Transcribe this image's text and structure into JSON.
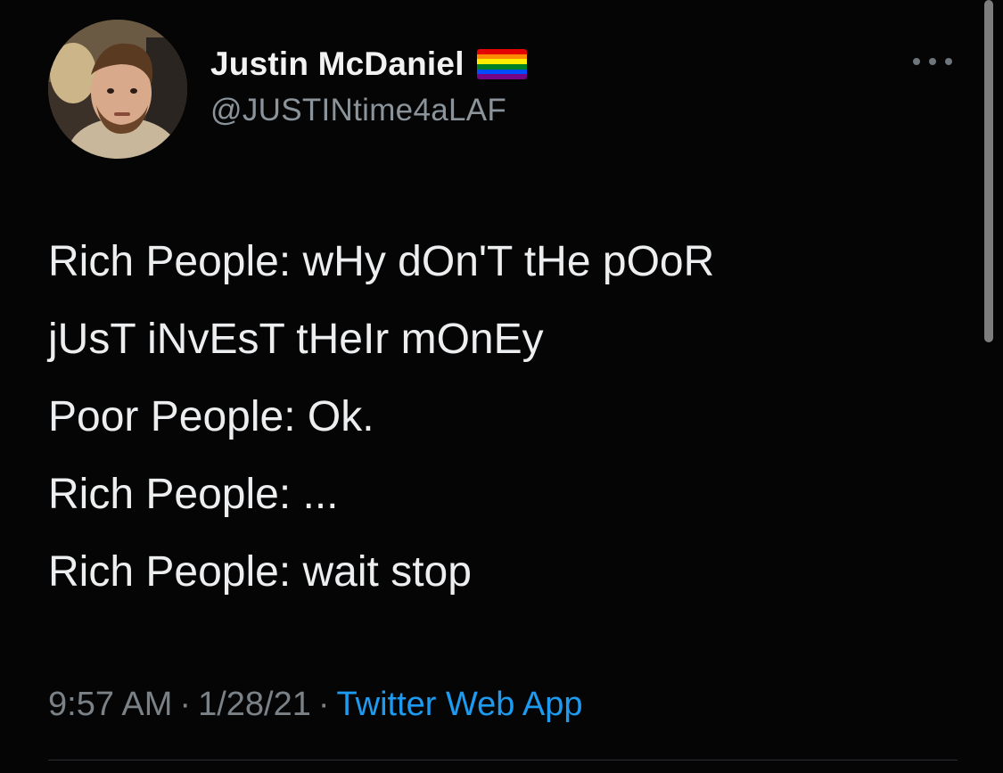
{
  "tweet": {
    "author": {
      "display_name": "Justin McDaniel",
      "handle": "@JUSTINtime4aLAF",
      "badge": "rainbow-flag-icon",
      "avatar": "avatar-photo"
    },
    "lines": [
      "Rich People: wHy dOn'T tHe pOoR",
      "jUsT iNvEsT tHeIr mOnEy",
      "Poor People: Ok.",
      "Rich People: ...",
      "Rich People: wait stop"
    ],
    "time": "9:57 AM",
    "date": "1/28/21",
    "separator": "·",
    "source": "Twitter Web App",
    "more_menu": "more-options-icon"
  },
  "colors": {
    "background": "#050505",
    "text": "#eceef0",
    "muted": "#7a8288",
    "link": "#1d9bf0",
    "flag": [
      "#e40303",
      "#ff8c00",
      "#ffed00",
      "#008026",
      "#004dff",
      "#750787"
    ]
  }
}
